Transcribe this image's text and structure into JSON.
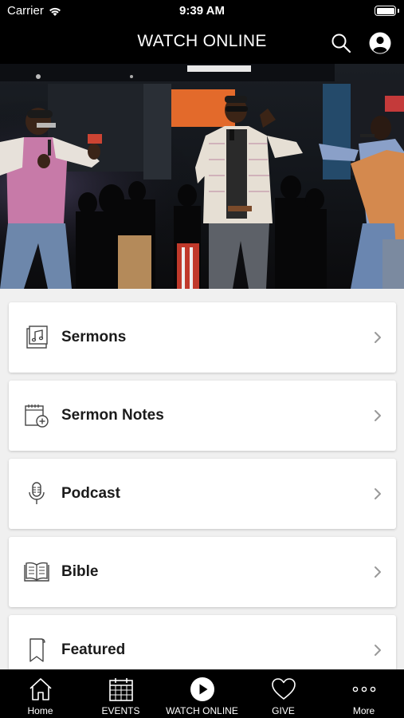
{
  "status_bar": {
    "carrier": "Carrier",
    "time": "9:39 AM"
  },
  "nav_bar": {
    "title": "WATCH ONLINE",
    "search_icon": "search-icon",
    "profile_icon": "profile-icon"
  },
  "hero": {
    "image_icon": "worship-photo"
  },
  "menu": [
    {
      "label": "Sermons",
      "icon": "music-album-icon"
    },
    {
      "label": "Sermon Notes",
      "icon": "notes-add-icon"
    },
    {
      "label": "Podcast",
      "icon": "microphone-icon"
    },
    {
      "label": "Bible",
      "icon": "book-icon"
    },
    {
      "label": "Featured",
      "icon": "bookmark-icon"
    }
  ],
  "tabs": [
    {
      "label": "Home",
      "icon": "home-icon"
    },
    {
      "label": "EVENTS",
      "icon": "calendar-icon"
    },
    {
      "label": "WATCH ONLINE",
      "icon": "play-icon",
      "active": true
    },
    {
      "label": "GIVE",
      "icon": "heart-icon"
    },
    {
      "label": "More",
      "icon": "more-icon"
    }
  ],
  "colors": {
    "bar_background": "#000000",
    "card_background": "#ffffff",
    "list_background": "#f0f0f0",
    "text": "#1b1b1b",
    "chevron": "#999999"
  }
}
